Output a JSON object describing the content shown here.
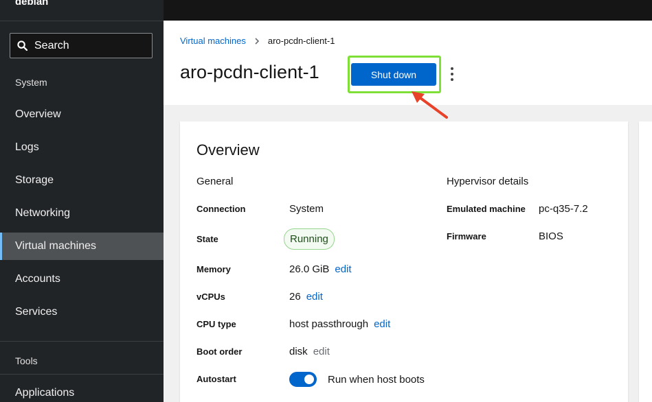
{
  "sidebar": {
    "host": "debian",
    "search_label": "Search",
    "sections": {
      "system": "System",
      "tools": "Tools"
    },
    "items": [
      {
        "label": "Overview"
      },
      {
        "label": "Logs"
      },
      {
        "label": "Storage"
      },
      {
        "label": "Networking"
      },
      {
        "label": "Virtual machines",
        "active": true
      },
      {
        "label": "Accounts"
      },
      {
        "label": "Services"
      }
    ],
    "tools_items": [
      {
        "label": "Applications"
      }
    ]
  },
  "header": {
    "breadcrumb_link": "Virtual machines",
    "breadcrumb_current": "aro-pcdn-client-1",
    "title": "aro-pcdn-client-1",
    "shutdown_label": "Shut down"
  },
  "overview": {
    "title": "Overview",
    "general": {
      "heading": "General",
      "connection_label": "Connection",
      "connection_value": "System",
      "state_label": "State",
      "state_value": "Running",
      "memory_label": "Memory",
      "memory_value": "26.0 GiB",
      "vcpus_label": "vCPUs",
      "vcpus_value": "26",
      "cpu_type_label": "CPU type",
      "cpu_type_value": "host passthrough",
      "boot_order_label": "Boot order",
      "boot_order_value": "disk",
      "autostart_label": "Autostart",
      "autostart_value": "Run when host boots",
      "edit_label": "edit"
    },
    "hypervisor": {
      "heading": "Hypervisor details",
      "emulated_machine_label": "Emulated machine",
      "emulated_machine_value": "pc-q35-7.2",
      "firmware_label": "Firmware",
      "firmware_value": "BIOS"
    }
  },
  "colors": {
    "accent": "#0066cc",
    "highlight": "#7ee037",
    "arrow": "#e8422a",
    "sidebar_bg": "#212427",
    "running_badge": "#95d58e"
  },
  "icons": [
    "search-icon",
    "chevron-right-icon",
    "kebab-icon",
    "arrow-annotation"
  ]
}
